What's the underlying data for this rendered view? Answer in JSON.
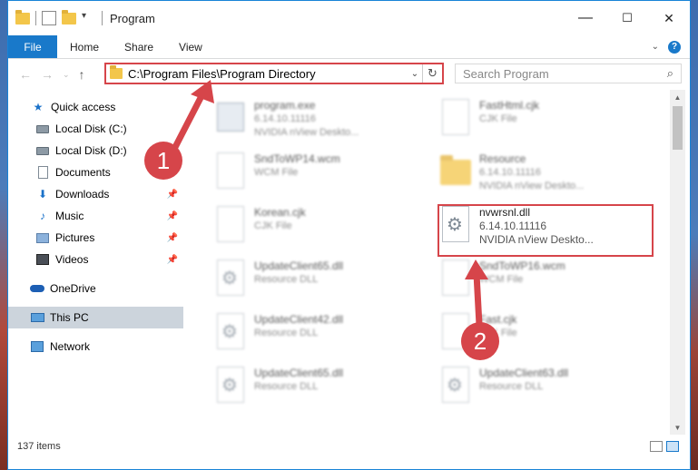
{
  "window": {
    "title": "Program",
    "minimize": "—",
    "maximize": "☐",
    "close": "✕"
  },
  "ribbon": {
    "tabs": [
      "File",
      "Home",
      "Share",
      "View"
    ],
    "help": "?"
  },
  "address": {
    "path": "C:\\Program Files\\Program Directory",
    "search_placeholder": "Search Program"
  },
  "navpane": {
    "items": [
      {
        "label": "Quick access",
        "icon": "star-icon"
      },
      {
        "label": "Local Disk (C:)",
        "icon": "disk-icon"
      },
      {
        "label": "Local Disk (D:)",
        "icon": "disk-icon"
      },
      {
        "label": "Documents",
        "icon": "documents-icon"
      },
      {
        "label": "Downloads",
        "icon": "downloads-icon",
        "pinned": true
      },
      {
        "label": "Music",
        "icon": "music-icon",
        "pinned": true
      },
      {
        "label": "Pictures",
        "icon": "pictures-icon",
        "pinned": true
      },
      {
        "label": "Videos",
        "icon": "videos-icon",
        "pinned": true
      },
      {
        "label": "OneDrive",
        "icon": "onedrive-icon"
      },
      {
        "label": "This PC",
        "icon": "pc-icon",
        "selected": true
      },
      {
        "label": "Network",
        "icon": "network-icon"
      }
    ]
  },
  "files": [
    {
      "name": "program.exe",
      "line1": "6.14.10.11116",
      "line2": "NVIDIA nView Deskto...",
      "icon": "exe-icon",
      "blurred": true
    },
    {
      "name": "FastHtml.cjk",
      "line1": "CJK File",
      "line2": "",
      "icon": "file-icon",
      "blurred": true
    },
    {
      "name": "SndToWP14.wcm",
      "line1": "WCM File",
      "line2": "",
      "icon": "file-icon",
      "blurred": true
    },
    {
      "name": "Resource",
      "line1": "6.14.10.11116",
      "line2": "NVIDIA nView Deskto...",
      "icon": "folder-icon",
      "blurred": true
    },
    {
      "name": "Korean.cjk",
      "line1": "CJK File",
      "line2": "",
      "icon": "file-icon",
      "blurred": true
    },
    {
      "name": "nvwrsnl.dll",
      "line1": "6.14.10.11116",
      "line2": "NVIDIA nView Deskto...",
      "icon": "dll-icon",
      "blurred": false
    },
    {
      "name": "UpdateClient65.dll",
      "line1": "Resource DLL",
      "line2": "",
      "icon": "dll-icon",
      "blurred": true
    },
    {
      "name": "SndToWP16.wcm",
      "line1": "WCM File",
      "line2": "",
      "icon": "file-icon",
      "blurred": true
    },
    {
      "name": "UpdateClient42.dll",
      "line1": "Resource DLL",
      "line2": "",
      "icon": "dll-icon",
      "blurred": true
    },
    {
      "name": "Fast.cjk",
      "line1": "CJK File",
      "line2": "",
      "icon": "file-icon",
      "blurred": true
    },
    {
      "name": "UpdateClient65.dll",
      "line1": "Resource DLL",
      "line2": "",
      "icon": "dll-icon",
      "blurred": true
    },
    {
      "name": "UpdateClient63.dll",
      "line1": "Resource DLL",
      "line2": "",
      "icon": "dll-icon",
      "blurred": true
    }
  ],
  "status": {
    "item_count": "137 items"
  },
  "annotations": {
    "step1": "1",
    "step2": "2",
    "accent": "#d6454a"
  }
}
